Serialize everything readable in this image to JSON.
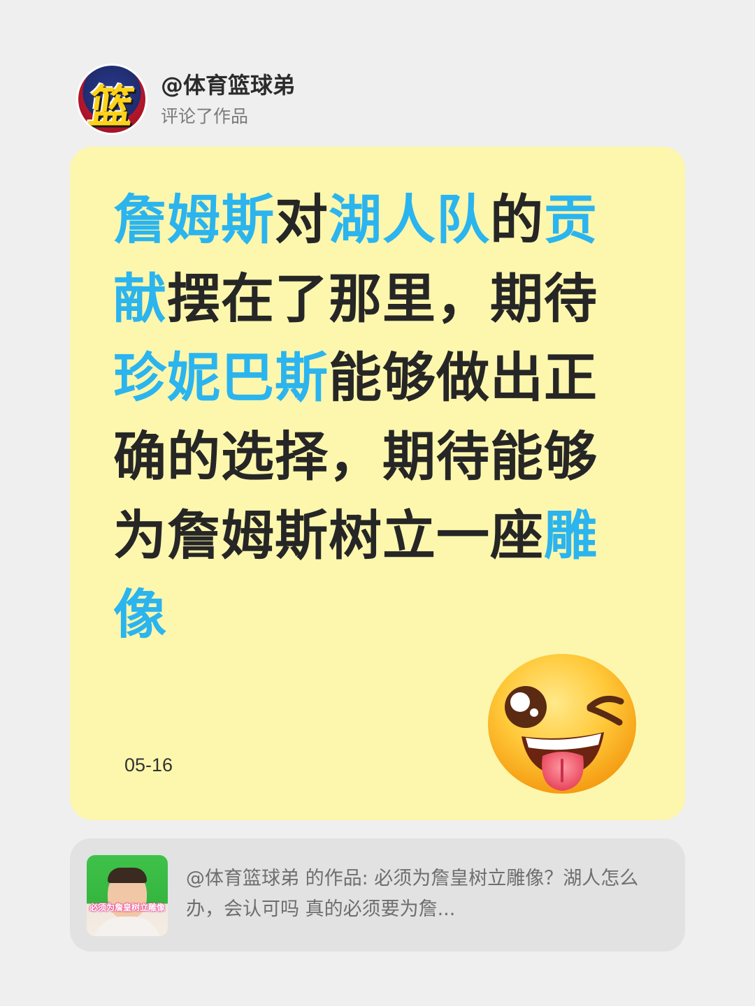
{
  "header": {
    "avatar_text": "篮",
    "username": "@体育篮球弟",
    "action": "评论了作品"
  },
  "comment": {
    "segments": [
      {
        "text": "詹姆斯",
        "highlight": true
      },
      {
        "text": "对",
        "highlight": false
      },
      {
        "text": "湖人队",
        "highlight": true
      },
      {
        "text": "的",
        "highlight": false
      },
      {
        "text": "贡献",
        "highlight": true
      },
      {
        "text": "摆在了那里，期待",
        "highlight": false
      },
      {
        "text": "珍妮巴斯",
        "highlight": true
      },
      {
        "text": "能够做出正确的选择，期待能够为詹姆斯树立一座",
        "highlight": false
      },
      {
        "text": "雕像",
        "highlight": true
      }
    ],
    "date": "05-16",
    "emoji": "winking-tongue-face-icon"
  },
  "work": {
    "thumbnail_caption": "必须为詹皇树立雕像",
    "text": "@体育篮球弟 的作品: 必须为詹皇树立雕像？湖人怎么办，会认可吗 真的必须要为詹..."
  },
  "colors": {
    "background": "#efefef",
    "card": "#fcf7ad",
    "highlight": "#2bb4ee",
    "text": "#262626",
    "work_card": "#e2e2e2"
  }
}
